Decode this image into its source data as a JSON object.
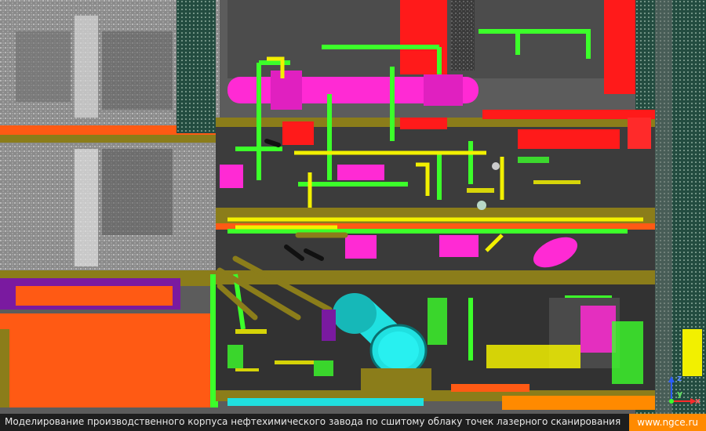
{
  "caption": "Моделирование производственного корпуса нефтехимического завода по сшитому облаку точек лазерного сканирования",
  "site_link": "www.ngce.ru",
  "axis_gizmo": {
    "z": "z",
    "y": "y",
    "x": "x"
  },
  "colors": {
    "background": "#5a5a5a",
    "caption_bar": "#1e1e1e",
    "badge": "#ff8a00",
    "magenta": "#ff2ad4",
    "green": "#3cff2a",
    "yellow": "#f2f000",
    "red": "#ff1a1a",
    "orange": "#ff5a14",
    "cyan": "#20e0e0",
    "olive": "#8b7d1a",
    "purple": "#7a1aa0"
  }
}
